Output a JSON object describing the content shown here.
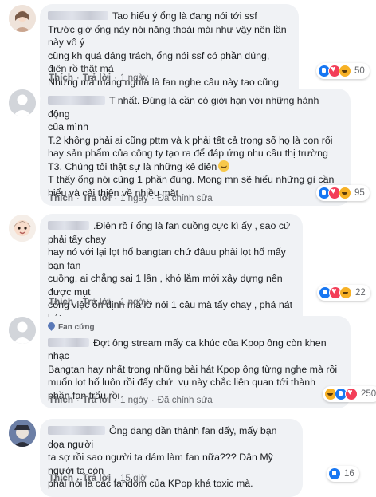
{
  "labels": {
    "like": "Thích",
    "reply": "Trả lời",
    "edited": "Đã chỉnh sửa"
  },
  "comments": [
    {
      "text_lines": [
        "Tao hiểu ý ổng là đang nói tới ssf",
        "Trước giờ ổng này nói năng thoải mái như vậy nên lần này vô ý",
        "cũng kh quá đáng trách, ổng nói ssf có phần đúng, điên rồ thật mà",
        "Nhưng mà mang nghĩa là fan nghe câu này tao cũng khó chịu"
      ],
      "time": "1 ngày",
      "reactions": [
        "like",
        "love",
        "haha"
      ],
      "count": "50"
    },
    {
      "text_lines": [
        "T nhất. Đúng là cần có giới hạn với những hành động",
        "của mình",
        "T.2 không phải ai cũng pttm và k phải tất cả trong số họ là con rối",
        "hay sản phẩm của công ty tạo ra để đáp ứng nhu cầu thị trường",
        "T3. Chúng tôi thật sự là những kẻ điên",
        "T thấy ổng nói cũng 1 phần đúng. Mong mn sẽ hiểu những gì cần",
        "hiểu và cải thiện về nhiều mặt"
      ],
      "time": "1 ngày",
      "edited": true,
      "reactions": [
        "like",
        "love",
        "haha"
      ],
      "count": "95"
    },
    {
      "text_lines": ".Điên rồ í ổng là fan cuồng cực kì ấy , sao cứ phải tẩy chay\nhay nó với lại lọt hố bangtan chứ đâuu phải lọt hố mấy bạn fan\ncuồng, ai chẳng sai 1 lần , khó lắm mới xây dựng nên được mụt\ncông việc ổn định mà lỡ nói 1 câu mà tẩy chay , phá nát bát cơm\nngta. Đâuu ai hoàn hảo đâu mấy bạn ơii",
      "time": "1 ngày",
      "reactions": [
        "like",
        "love",
        "haha"
      ],
      "count": "22"
    },
    {
      "badge": "Fan cứng",
      "text": "Đợt ông stream mấy ca khúc của Kpop ông còn khen nhạc\nBangtan hay nhất trong những bài hát Kpop ông từng nghe mà rồi\nmuốn lọt hố luôn rồi đấy chứ  vụ này chắc liên quan tới thành\nphần fan trẩu rồi",
      "time": "1 ngày",
      "edited": true,
      "reactions": [
        "haha",
        "like",
        "love"
      ],
      "count": "250"
    },
    {
      "text": "Ông đang dần thành fan đấy, mấy bạn dọa người\nta sợ rồi sao người ta dám làm fan nữa??? Dân Mỹ người ta còn\nphải nói là các fandom của KPop khá toxic mà.",
      "time": "15 giờ",
      "reactions": [
        "like"
      ],
      "count": "16"
    }
  ]
}
